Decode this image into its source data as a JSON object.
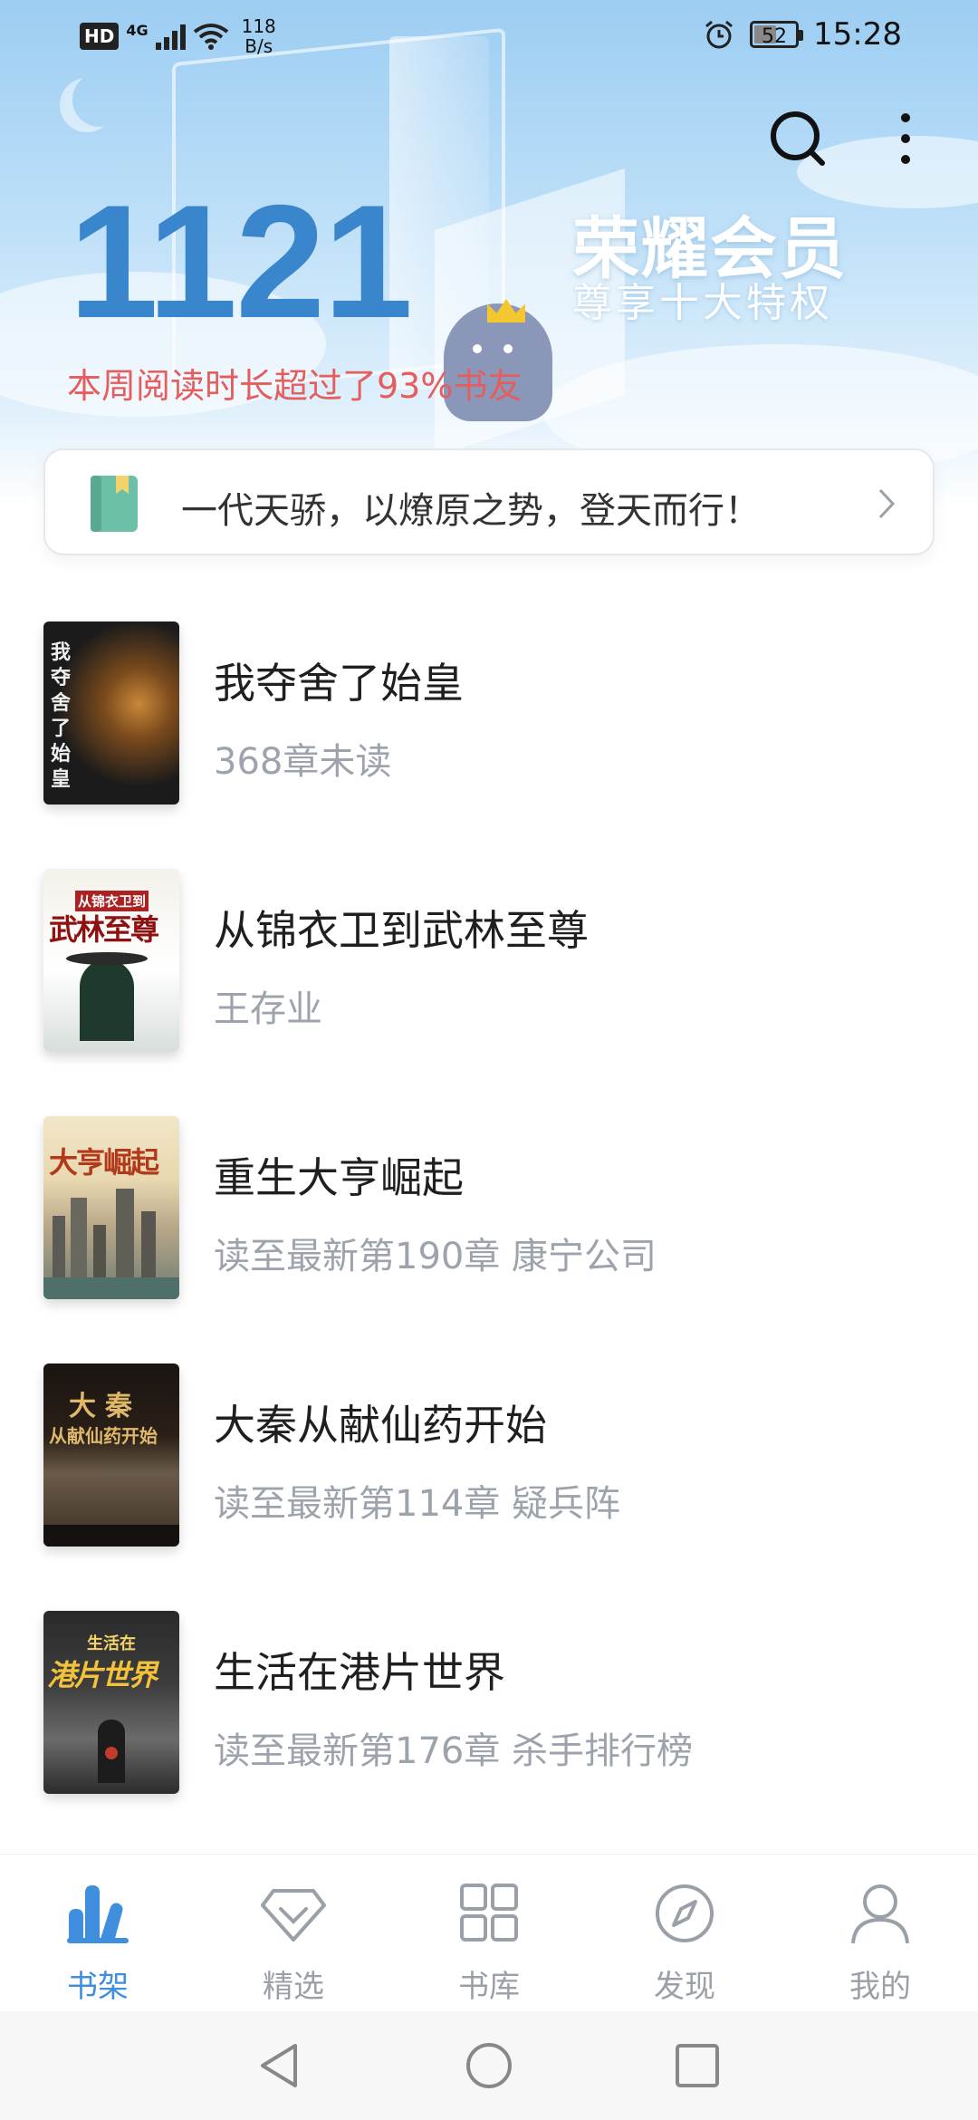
{
  "status_bar": {
    "hd": "HD",
    "network": "4G",
    "speed_value": "118",
    "speed_unit": "B/s",
    "battery": "52",
    "time": "15:28"
  },
  "header": {
    "reading_stat": "1121",
    "reading_desc": "本周阅读时长超过了93%书友",
    "vip_title": "荣耀会员",
    "vip_subtitle": "尊享十大特权",
    "icons": [
      "search-icon",
      "more-vertical-icon"
    ]
  },
  "notice": {
    "text": "一代天骄，以燎原之势，登天而行！",
    "icon": "book-bookmark-icon"
  },
  "books": [
    {
      "title": "我夺舍了始皇",
      "subtitle": "368章未读",
      "cover_text": "我夺舍了始皇"
    },
    {
      "title": "从锦衣卫到武林至尊",
      "subtitle": "王存业",
      "cover_text": "武林至尊",
      "cover_top_text": "从锦衣卫到"
    },
    {
      "title": "重生大亨崛起",
      "subtitle": "读至最新第190章 康宁公司",
      "cover_text": "大亨崛起"
    },
    {
      "title": "大秦从献仙药开始",
      "subtitle": "读至最新第114章 疑兵阵",
      "cover_text": "大秦",
      "cover_sub_text": "从献仙药开始"
    },
    {
      "title": "生活在港片世界",
      "subtitle": "读至最新第176章 杀手排行榜",
      "cover_text": "港片世界",
      "cover_top_text": "生活在"
    }
  ],
  "bottom_nav": [
    {
      "label": "书架",
      "icon": "bookshelf-icon",
      "active": true
    },
    {
      "label": "精选",
      "icon": "diamond-icon",
      "active": false
    },
    {
      "label": "书库",
      "icon": "grid-icon",
      "active": false
    },
    {
      "label": "发现",
      "icon": "compass-icon",
      "active": false
    },
    {
      "label": "我的",
      "icon": "user-icon",
      "active": false
    }
  ],
  "colors": {
    "accent": "#3f8fde",
    "stat_number": "#3a86cc",
    "stat_desc": "#e55d5d",
    "muted": "#9da3ad"
  }
}
